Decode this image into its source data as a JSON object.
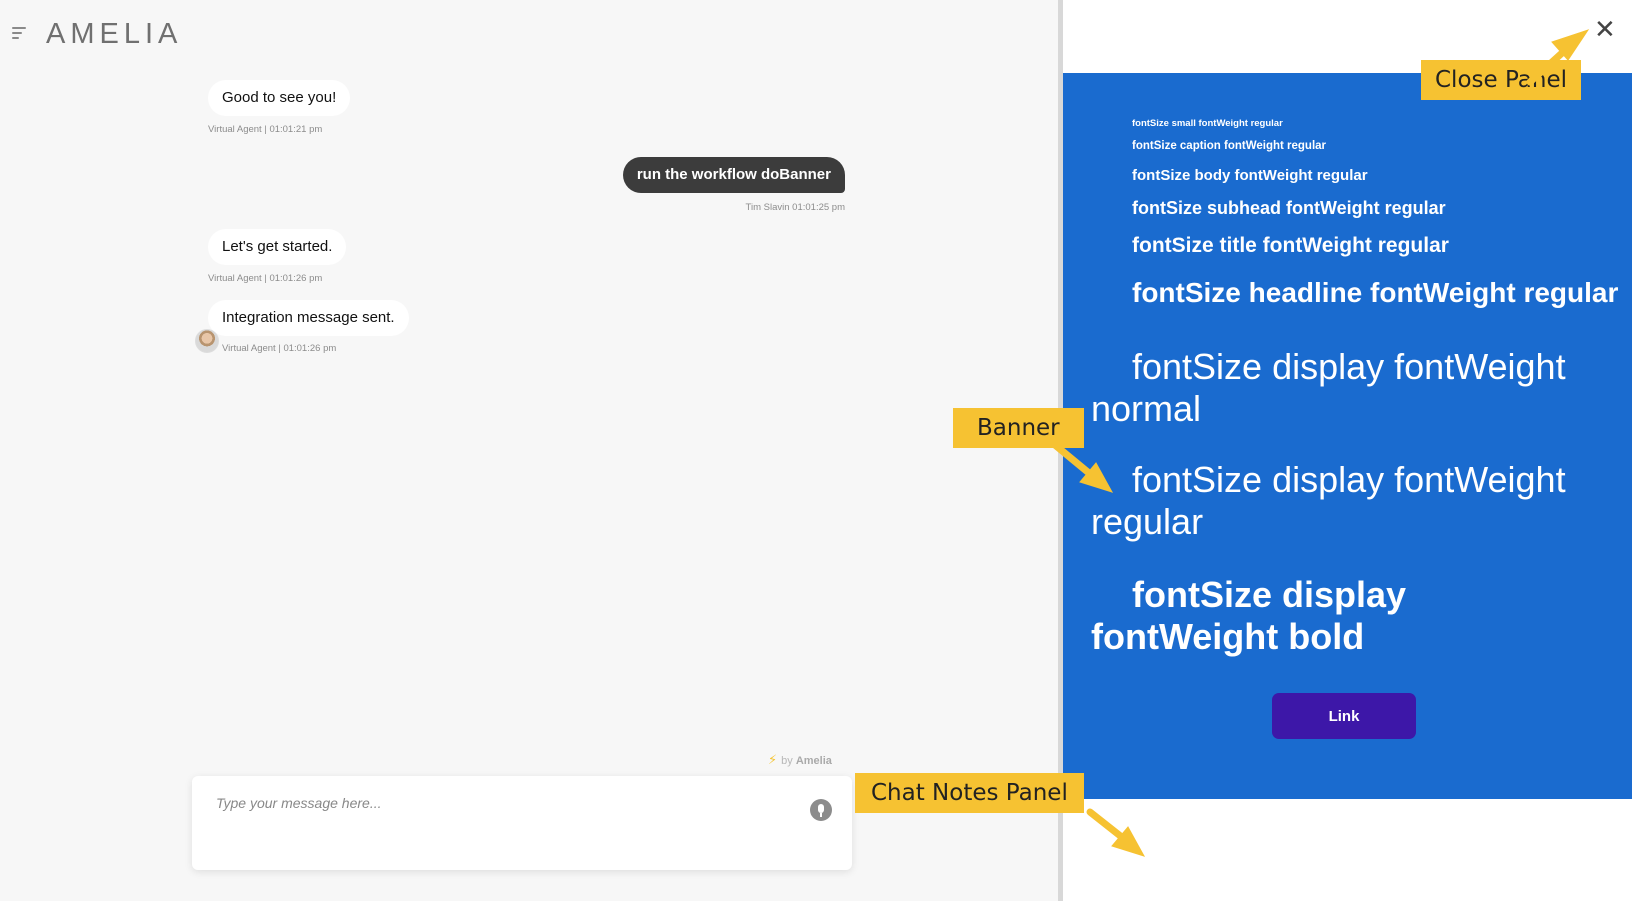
{
  "app": {
    "logo": "AMELIA"
  },
  "messages": [
    {
      "sender": "agent",
      "text": "Good to see you!",
      "meta": "Virtual Agent | 01:01:21 pm"
    },
    {
      "sender": "user",
      "text": "run the workflow doBanner",
      "meta": "Tim Slavin 01:01:25 pm"
    },
    {
      "sender": "agent",
      "text": "Let's get started.",
      "meta": "Virtual Agent | 01:01:26 pm"
    },
    {
      "sender": "agent",
      "text": "Integration message sent.",
      "meta": "Virtual Agent | 01:01:26 pm"
    }
  ],
  "powered_by": {
    "prefix": "by",
    "brand": "Amelia"
  },
  "input": {
    "placeholder": "Type your message here..."
  },
  "banner": {
    "color": "#1a6bcf",
    "lines": [
      "fontSize small fontWeight regular",
      "fontSize caption fontWeight regular",
      "fontSize body fontWeight regular",
      "fontSize subhead fontWeight regular",
      "fontSize title fontWeight regular",
      "fontSize headline fontWeight regular",
      "fontSize display fontWeight normal",
      "fontSize display fontWeight regular",
      "fontSize display fontWeight bold"
    ],
    "link_label": "Link"
  },
  "annotations": {
    "close_panel": "Close Panel",
    "banner": "Banner",
    "chat_notes_panel": "Chat Notes Panel",
    "color": "#f6c232"
  }
}
